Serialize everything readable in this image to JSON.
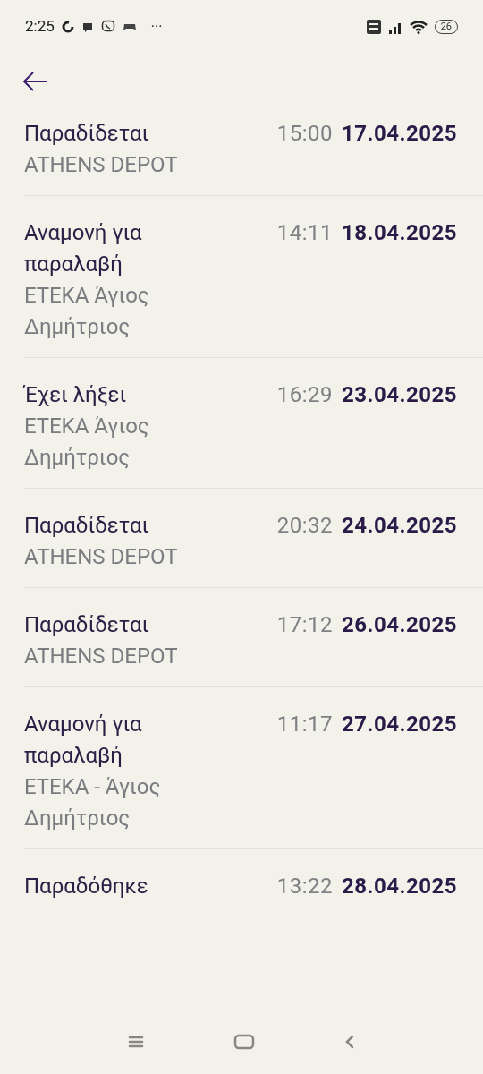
{
  "status_bar": {
    "time": "2:25",
    "more": "···",
    "battery": "26"
  },
  "events": [
    {
      "status": "Παραδίδεται",
      "location": "ATHENS DEPOT",
      "time": "15:00",
      "date": "17.04.2025"
    },
    {
      "status": "Αναμονή για παραλαβή",
      "location": "ΕΤΕΚΑ Άγιος Δημήτριος",
      "time": "14:11",
      "date": "18.04.2025"
    },
    {
      "status": "Έχει λήξει",
      "location": "ΕΤΕΚΑ Άγιος Δημήτριος",
      "time": "16:29",
      "date": "23.04.2025"
    },
    {
      "status": "Παραδίδεται",
      "location": "ATHENS DEPOT",
      "time": "20:32",
      "date": "24.04.2025"
    },
    {
      "status": "Παραδίδεται",
      "location": "ATHENS DEPOT",
      "time": "17:12",
      "date": "26.04.2025"
    },
    {
      "status": "Αναμονή για παραλαβή",
      "location": "ΕΤΕΚΑ - Άγιος Δημήτριος",
      "time": "11:17",
      "date": "27.04.2025"
    },
    {
      "status": "Παραδόθηκε",
      "time": "13:22",
      "date": "28.04.2025"
    }
  ]
}
